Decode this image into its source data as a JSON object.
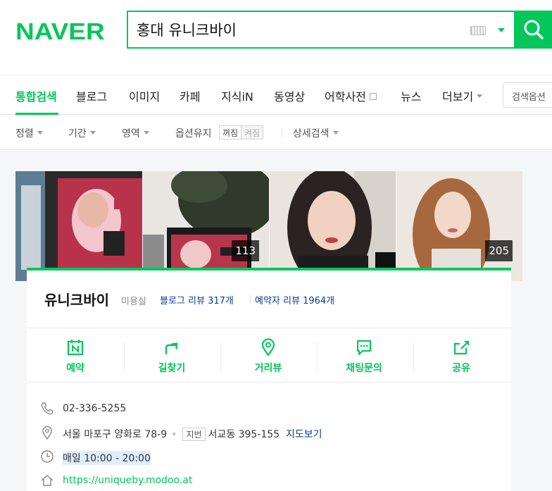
{
  "brand": {
    "logo": "NAVER",
    "accent": "#03c75a"
  },
  "search": {
    "query": "홍대 유니크바이"
  },
  "tabs": [
    {
      "label": "통합검색",
      "active": true
    },
    {
      "label": "블로그"
    },
    {
      "label": "이미지"
    },
    {
      "label": "카페"
    },
    {
      "label": "지식iN"
    },
    {
      "label": "동영상"
    },
    {
      "label": "어학사전"
    },
    {
      "label": "뉴스"
    },
    {
      "label": "더보기"
    }
  ],
  "search_options_label": "검색옵션",
  "filters": {
    "sort": "정렬",
    "period": "기간",
    "area": "영역",
    "keep_options": "옵션유지",
    "toggle_on": "꺼짐",
    "toggle_off": "켜짐",
    "detail": "상세검색"
  },
  "photos": [
    {
      "icon": "salon-exterior-photo"
    },
    {
      "icon": "salon-sign-photo",
      "count": "113"
    },
    {
      "icon": "woman-portrait-photo"
    },
    {
      "icon": "woman-hair-photo",
      "count": "205"
    }
  ],
  "place": {
    "name": "유니크바이",
    "category": "미용실",
    "blog_reviews": "블로그 리뷰 317개",
    "booking_reviews": "예약자 리뷰 1964개"
  },
  "actions": [
    {
      "label": "예약",
      "icon": "calendar-icon"
    },
    {
      "label": "길찾기",
      "icon": "directions-icon"
    },
    {
      "label": "거리뷰",
      "icon": "streetview-pin-icon"
    },
    {
      "label": "채팅문의",
      "icon": "chat-icon"
    },
    {
      "label": "공유",
      "icon": "share-icon"
    }
  ],
  "info": {
    "phone": "02-336-5255",
    "address": "서울 마포구 양화로 78-9",
    "jibun_badge": "지번",
    "jibun": "서교동 395-155",
    "map_link": "지도보기",
    "hours": "매일 10:00 - 20:00",
    "website": "https://uniqueby.modoo.at"
  }
}
